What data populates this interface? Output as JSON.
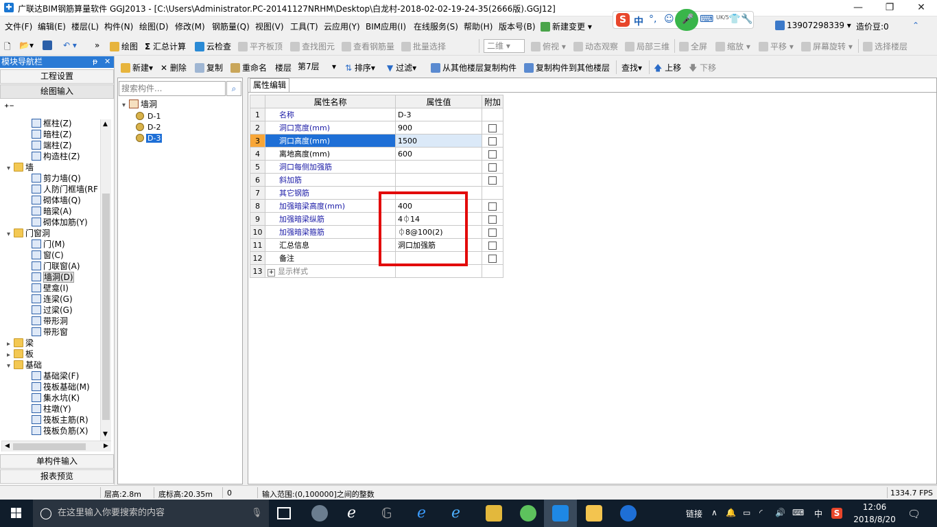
{
  "window": {
    "title": "广联达BIM钢筋算量软件 GGJ2013 - [C:\\Users\\Administrator.PC-20141127NRHM\\Desktop\\白龙村-2018-02-02-19-24-35(2666版).GGJ12]",
    "minimize": "—",
    "restore": "❐",
    "close": "✕"
  },
  "menubar": {
    "items": [
      "文件(F)",
      "编辑(E)",
      "楼层(L)",
      "构件(N)",
      "绘图(D)",
      "修改(M)",
      "钢筋量(Q)",
      "视图(V)",
      "工具(T)",
      "云应用(Y)",
      "BIM应用(I)",
      "在线服务(S)",
      "帮助(H)",
      "版本号(B)",
      "新建变更"
    ],
    "phone": "13907298339",
    "cost_label": "造价豆:0",
    "ime": {
      "logo": "S",
      "lang": "中",
      "punct": "°,",
      "badge": "UK/5"
    }
  },
  "toolbar1": {
    "draw": "绘图",
    "sum": "汇总计算",
    "cloud_check": "云检查",
    "align_top": "平齐板顶",
    "find_elem": "查找图元",
    "view_rebar": "查看钢筋量",
    "batch_select": "批量选择",
    "view_mode": "二维",
    "top_view": "俯视",
    "dynamic_view": "动态观察",
    "local_3d": "局部三维",
    "fullscreen": "全屏",
    "zoom": "缩放",
    "pan": "平移",
    "rotate": "屏幕旋转",
    "select_floor": "选择楼层"
  },
  "toolbar2": {
    "new": "新建",
    "delete": "删除",
    "copy": "复制",
    "rename": "重命名",
    "floor_label": "楼层",
    "floor_value": "第7层",
    "sort": "排序",
    "filter": "过滤",
    "copy_from": "从其他楼层复制构件",
    "copy_to": "复制构件到其他楼层",
    "find": "查找",
    "move_up": "上移",
    "move_down": "下移"
  },
  "nav": {
    "header": "模块导航栏",
    "pin": "ᵽ",
    "close": "✕",
    "project_settings": "工程设置",
    "drawing_input": "绘图输入",
    "single_input": "单构件输入",
    "report_preview": "报表预览",
    "tree": [
      {
        "label": "框柱(Z)",
        "level": 2
      },
      {
        "label": "暗柱(Z)",
        "level": 2
      },
      {
        "label": "端柱(Z)",
        "level": 2
      },
      {
        "label": "构造柱(Z)",
        "level": 2
      },
      {
        "label": "墙",
        "level": 1,
        "folder": true,
        "expanded": true
      },
      {
        "label": "剪力墙(Q)",
        "level": 2
      },
      {
        "label": "人防门框墙(RF",
        "level": 2
      },
      {
        "label": "砌体墙(Q)",
        "level": 2
      },
      {
        "label": "暗梁(A)",
        "level": 2
      },
      {
        "label": "砌体加筋(Y)",
        "level": 2
      },
      {
        "label": "门窗洞",
        "level": 1,
        "folder": true,
        "expanded": true
      },
      {
        "label": "门(M)",
        "level": 2
      },
      {
        "label": "窗(C)",
        "level": 2
      },
      {
        "label": "门联窗(A)",
        "level": 2
      },
      {
        "label": "墙洞(D)",
        "level": 2,
        "selected": true
      },
      {
        "label": "壁龛(I)",
        "level": 2
      },
      {
        "label": "连梁(G)",
        "level": 2
      },
      {
        "label": "过梁(G)",
        "level": 2
      },
      {
        "label": "带形洞",
        "level": 2
      },
      {
        "label": "带形窗",
        "level": 2
      },
      {
        "label": "梁",
        "level": 1,
        "folder": true,
        "expanded": false
      },
      {
        "label": "板",
        "level": 1,
        "folder": true,
        "expanded": false
      },
      {
        "label": "基础",
        "level": 1,
        "folder": true,
        "expanded": true
      },
      {
        "label": "基础梁(F)",
        "level": 2
      },
      {
        "label": "筏板基础(M)",
        "level": 2
      },
      {
        "label": "集水坑(K)",
        "level": 2
      },
      {
        "label": "柱墩(Y)",
        "level": 2
      },
      {
        "label": "筏板主筋(R)",
        "level": 2
      },
      {
        "label": "筏板负筋(X)",
        "level": 2
      }
    ]
  },
  "component_list": {
    "search_placeholder": "搜索构件...",
    "root": "墙洞",
    "items": [
      "D-1",
      "D-2",
      "D-3"
    ],
    "selected_index": 2
  },
  "property_editor": {
    "tab": "属性编辑",
    "col_name": "属性名称",
    "col_value": "属性值",
    "col_extra": "附加",
    "rows": [
      {
        "num": "1",
        "name": "名称",
        "value": "D-3",
        "check": false,
        "color": "blue"
      },
      {
        "num": "2",
        "name": "洞口宽度(mm)",
        "value": "900",
        "check": true,
        "color": "blue"
      },
      {
        "num": "3",
        "name": "洞口高度(mm)",
        "value": "1500",
        "check": true,
        "color": "blue",
        "selected": true
      },
      {
        "num": "4",
        "name": "离地高度(mm)",
        "value": "600",
        "check": true,
        "color": "black"
      },
      {
        "num": "5",
        "name": "洞口每侧加强筋",
        "value": "",
        "check": true,
        "color": "blue"
      },
      {
        "num": "6",
        "name": "斜加筋",
        "value": "",
        "check": true,
        "color": "blue"
      },
      {
        "num": "7",
        "name": "其它钢筋",
        "value": "",
        "check": false,
        "color": "blue"
      },
      {
        "num": "8",
        "name": "加强暗梁高度(mm)",
        "value": "400",
        "check": true,
        "color": "blue"
      },
      {
        "num": "9",
        "name": "加强暗梁纵筋",
        "value": "4⏀14",
        "check": true,
        "color": "blue"
      },
      {
        "num": "10",
        "name": "加强暗梁箍筋",
        "value": "⏀8@100(2)",
        "check": true,
        "color": "blue"
      },
      {
        "num": "11",
        "name": "汇总信息",
        "value": "洞口加强筋",
        "check": true,
        "color": "black"
      },
      {
        "num": "12",
        "name": "备注",
        "value": "",
        "check": true,
        "color": "black"
      },
      {
        "num": "13",
        "name": "显示样式",
        "value": "",
        "check": false,
        "color": "gray",
        "expandable": true
      }
    ],
    "highlight_color": "#e20b0b"
  },
  "statusbar": {
    "floor_height": "层高:2.8m",
    "bottom_elev": "底标高:20.35m",
    "zero": "0",
    "hint": "输入范围:(0,100000]之间的整数",
    "fps": "1334.7 FPS"
  },
  "taskbar": {
    "search_placeholder": "在这里输入你要搜索的内容",
    "link_label": "链接",
    "ime_lang": "中",
    "time": "12:06",
    "date": "2018/8/20"
  }
}
